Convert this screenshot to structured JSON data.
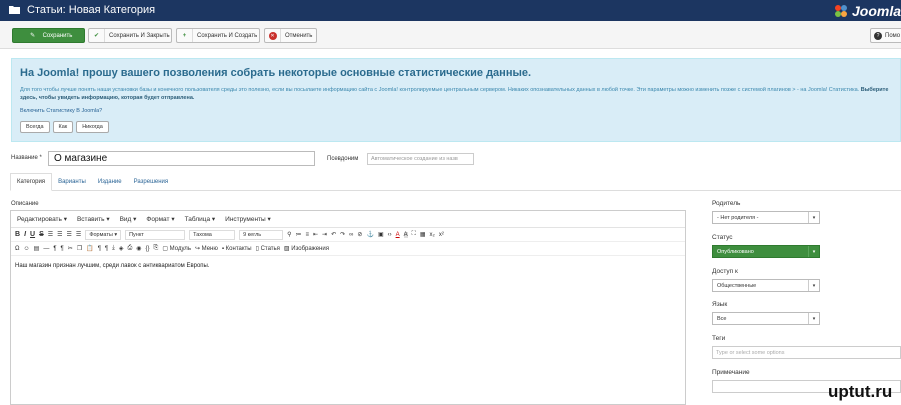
{
  "app": {
    "title": "Статьи: Новая Категория",
    "brand": "Joomla"
  },
  "toolbar": {
    "save": "Сохранить",
    "save_close": "Сохранить И Закрыть",
    "save_new": "Сохранить И Создать",
    "cancel": "Отменить",
    "help": "Помо"
  },
  "message": {
    "heading": "На Joomla! прошу вашего позволения собрать некоторые основные статистические данные.",
    "body": "Для того чтобы лучше понять наши установки базы и конечного пользователя среды это полезно, если вы посылаете информацию сайта с Joomla! контролируемые центральным сервером. Никаких опознавательных данных в любой точке. Эти параметры можно изменить позже с системой плагинов > - на Joomla! Статистика.",
    "body_bold": "Выберите здесь, чтобы увидеть информацию, которая будет отправлена.",
    "link": "Включить Статистику В Joomla?",
    "choices": [
      "Всегда",
      "Как",
      "Никогда"
    ]
  },
  "form": {
    "title_label": "Название *",
    "title_value": "О магазине",
    "alias_label": "Псевдоним",
    "alias_placeholder": "Автоматическое создание из назв"
  },
  "tabs": [
    "Категория",
    "Варианты",
    "Издание",
    "Разрешения"
  ],
  "editor": {
    "label": "Описание",
    "menus": [
      "Редактировать ▾",
      "Вставить ▾",
      "Вид ▾",
      "Формат ▾",
      "Таблица ▾",
      "Инструменты ▾"
    ],
    "formats": "Форматы ▾",
    "block": "Пункт",
    "font": "Тахома",
    "size": "9 кегль",
    "module": "Модуль",
    "menu": "Меню",
    "contacts": "Контакты",
    "article": "Статья",
    "images": "Изображения",
    "content": "Наш магазин признан лучшим, среди лавок с антиквариатом Европы."
  },
  "sidebar": {
    "parent_label": "Родитель",
    "parent_value": "- Нет родителя -",
    "status_label": "Статус",
    "status_value": "Опубликовано",
    "access_label": "Доступ к",
    "access_value": "Общественные",
    "language_label": "Язык",
    "language_value": "Все",
    "tags_label": "Теги",
    "tags_placeholder": "Type or select some options",
    "note_label": "Примечание"
  },
  "watermark": "uptut.ru",
  "colors": {
    "navbar": "#1c3661",
    "save": "#3e8e3e",
    "info_bg": "#d9edf7"
  }
}
